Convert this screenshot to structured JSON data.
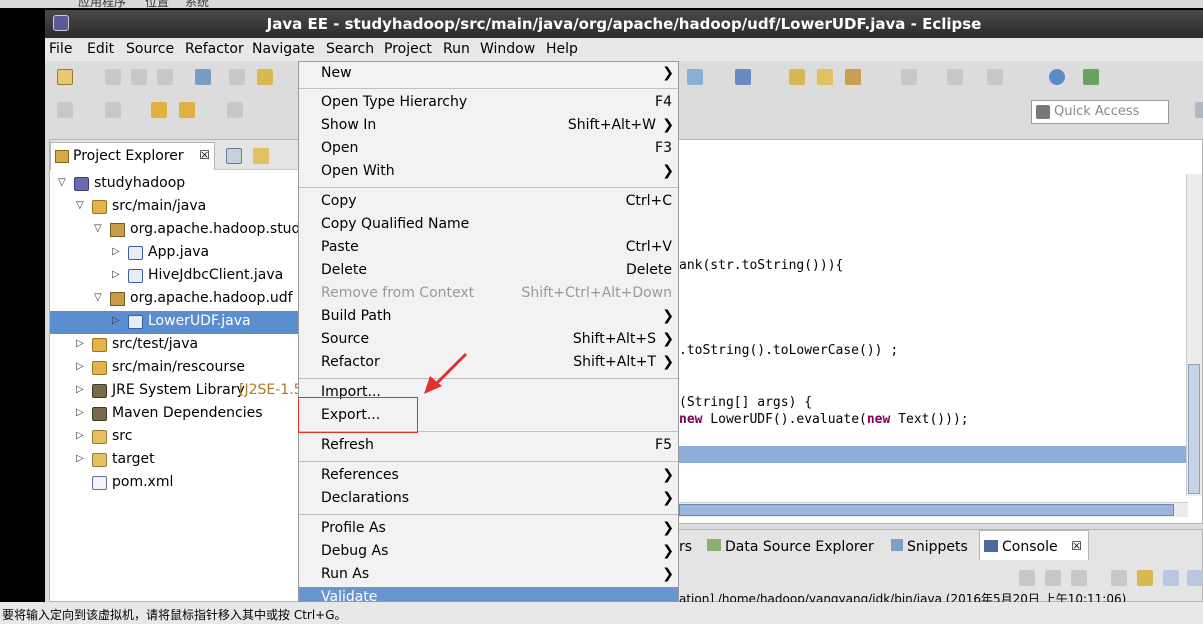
{
  "host_bar": {
    "items": [
      "应用程序",
      "位置",
      "系统"
    ]
  },
  "window": {
    "title": "Java EE - studyhadoop/src/main/java/org/apache/hadoop/udf/LowerUDF.java - Eclipse"
  },
  "menubar": {
    "items": [
      "File",
      "Edit",
      "Source",
      "Refactor",
      "Navigate",
      "Search",
      "Project",
      "Run",
      "Window",
      "Help"
    ]
  },
  "quick_access": {
    "placeholder": "Quick Access"
  },
  "explorer": {
    "tab_label": "Project Explorer",
    "close_glyph": "☒",
    "tree": [
      {
        "label": "studyhadoop",
        "decoration": "",
        "icon": "project-icon",
        "expanded": true,
        "depth": 0
      },
      {
        "label": "src/main/java",
        "decoration": "",
        "icon": "source-folder-icon",
        "expanded": true,
        "depth": 1
      },
      {
        "label": "org.apache.hadoop.studyh",
        "decoration": "",
        "icon": "package-icon",
        "expanded": true,
        "depth": 2
      },
      {
        "label": "App.java",
        "decoration": "",
        "icon": "java-file-icon",
        "expanded": false,
        "depth": 3
      },
      {
        "label": "HiveJdbcClient.java",
        "decoration": "",
        "icon": "java-file-icon",
        "expanded": false,
        "depth": 3
      },
      {
        "label": "org.apache.hadoop.udf",
        "decoration": "",
        "icon": "package-icon",
        "expanded": true,
        "depth": 2
      },
      {
        "label": "LowerUDF.java",
        "decoration": "",
        "icon": "java-file-icon",
        "expanded": false,
        "depth": 3,
        "selected": true
      },
      {
        "label": "src/test/java",
        "decoration": "",
        "icon": "source-folder-icon",
        "expanded": false,
        "depth": 1
      },
      {
        "label": "src/main/rescourse",
        "decoration": "",
        "icon": "source-folder-icon",
        "expanded": false,
        "depth": 1
      },
      {
        "label": "JRE System Library",
        "decoration": "[J2SE-1.5",
        "icon": "library-icon",
        "expanded": false,
        "depth": 1
      },
      {
        "label": "Maven Dependencies",
        "decoration": "",
        "icon": "library-icon",
        "expanded": false,
        "depth": 1
      },
      {
        "label": "src",
        "decoration": "",
        "icon": "folder-icon",
        "expanded": false,
        "depth": 1
      },
      {
        "label": "target",
        "decoration": "",
        "icon": "folder-icon",
        "expanded": false,
        "depth": 1
      },
      {
        "label": "pom.xml",
        "decoration": "",
        "icon": "xml-file-icon",
        "expanded": null,
        "depth": 1
      }
    ]
  },
  "editor": {
    "lines": {
      "l1": "ank(str.toString())){",
      "l2": ".toString().toLowerCase()) ;",
      "l3": "(String[] args) {",
      "l4_kw1": "new",
      "l4_mid": " LowerUDF().evaluate(",
      "l4_kw2": "new",
      "l4_end": " Text()));"
    }
  },
  "bottom_panel": {
    "partial_tab": "rs",
    "tabs": [
      "Data Source Explorer",
      "Snippets"
    ],
    "console_tab": "Console",
    "console_line": "ation] /home/hadoop/yangyang/jdk/bin/java (2016年5月20日 上午10:11:06)"
  },
  "context_menu": {
    "items": {
      "new": {
        "label": "New",
        "accel": "N",
        "shortcut": ""
      },
      "open_type_hierarchy": {
        "label": "Open Type Hierarchy",
        "shortcut": "F4"
      },
      "show_in": {
        "label": "Show In",
        "shortcut": "Shift+Alt+W"
      },
      "open": {
        "label": "Open",
        "shortcut": "F3"
      },
      "open_with": {
        "label": "Open With",
        "shortcut": ""
      },
      "copy": {
        "label": "Copy",
        "shortcut": "Ctrl+C"
      },
      "copy_qualified_name": {
        "label": "Copy Qualified Name",
        "shortcut": ""
      },
      "paste": {
        "label": "Paste",
        "shortcut": "Ctrl+V"
      },
      "delete": {
        "label": "Delete",
        "shortcut": "Delete"
      },
      "remove_from_context": {
        "label": "Remove from Context",
        "shortcut": "Shift+Ctrl+Alt+Down"
      },
      "build_path": {
        "label": "Build Path",
        "shortcut": ""
      },
      "source": {
        "label": "Source",
        "shortcut": "Shift+Alt+S"
      },
      "refactor": {
        "label": "Refactor",
        "shortcut": "Shift+Alt+T"
      },
      "import": {
        "label": "Import...",
        "shortcut": ""
      },
      "export": {
        "label": "Export...",
        "shortcut": ""
      },
      "refresh": {
        "label": "Refresh",
        "shortcut": "F5"
      },
      "references": {
        "label": "References",
        "shortcut": ""
      },
      "declarations": {
        "label": "Declarations",
        "shortcut": ""
      },
      "profile_as": {
        "label": "Profile As",
        "shortcut": ""
      },
      "debug_as": {
        "label": "Debug As",
        "shortcut": ""
      },
      "run_as": {
        "label": "Run As",
        "shortcut": ""
      },
      "validate": {
        "label": "Validate",
        "shortcut": ""
      }
    },
    "submenu_glyph": "❯"
  },
  "status": {
    "text": "要将输入定向到该虚拟机，请将鼠标指针移入其中或按 Ctrl+G。"
  },
  "colors": {
    "selection": "#5b8ed0",
    "menu_hover": "#6a96d0",
    "annotation": "#e03030",
    "keyword": "#7f0055"
  }
}
